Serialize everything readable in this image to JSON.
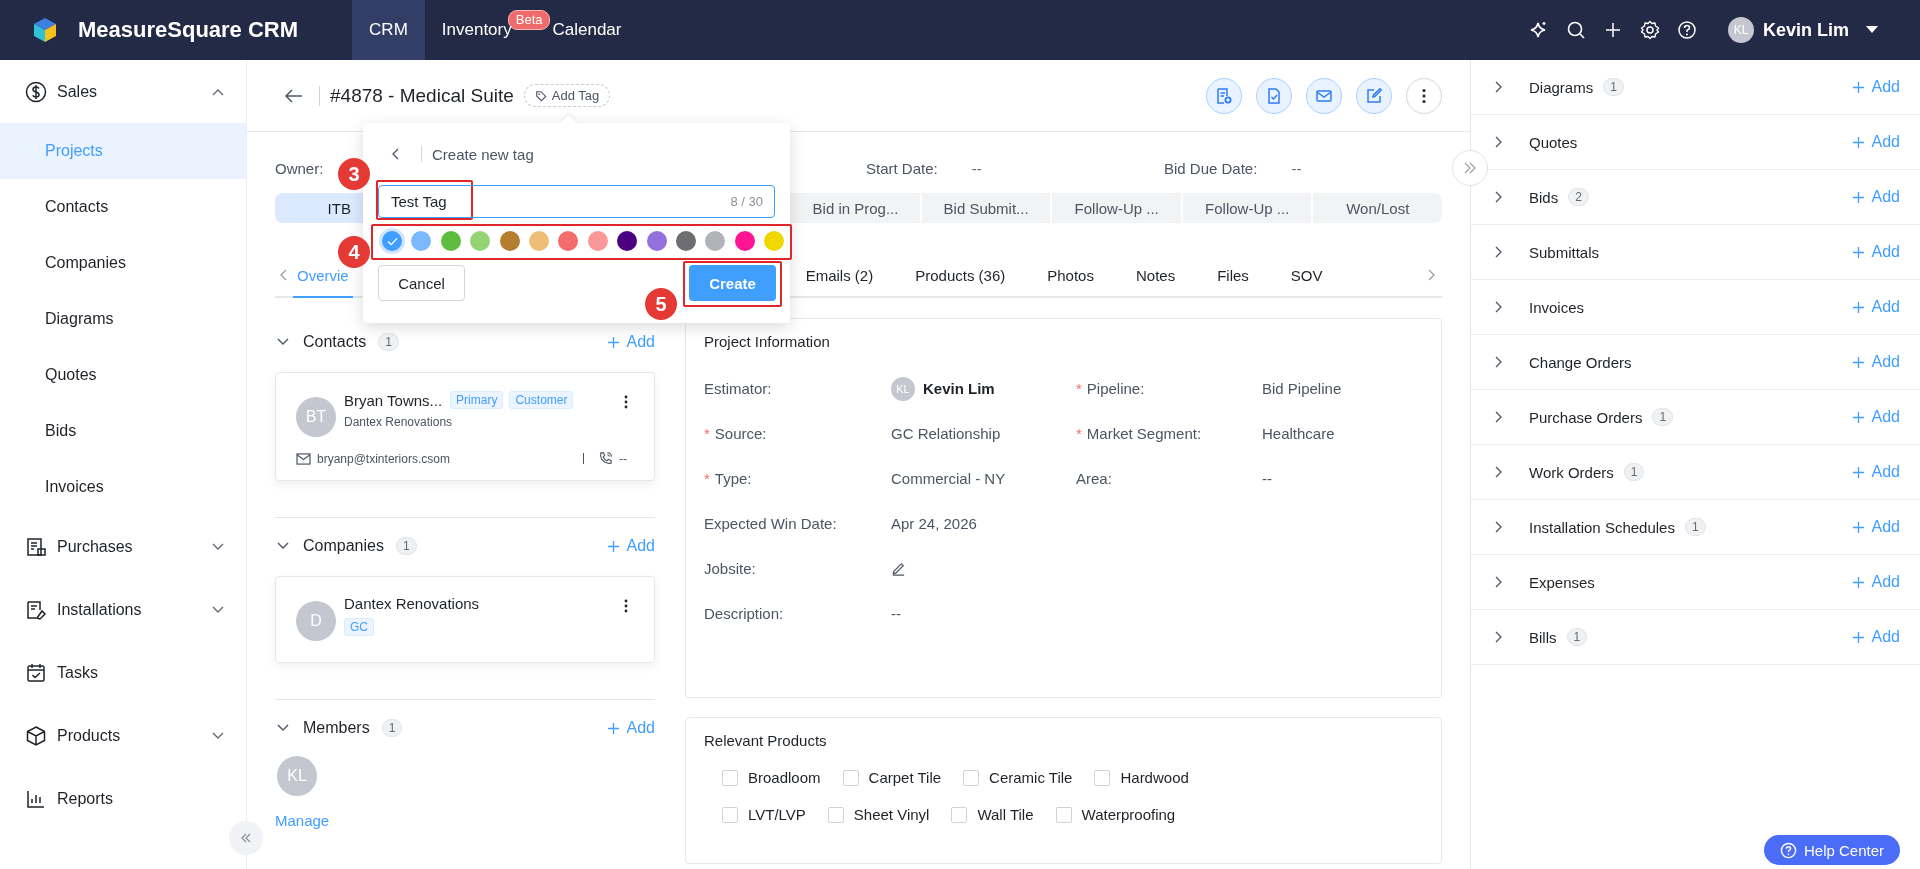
{
  "header": {
    "brand": "MeasureSquare CRM",
    "nav": [
      {
        "label": "CRM",
        "selected": true
      },
      {
        "label": "Inventory",
        "selected": false,
        "badge": "Beta"
      },
      {
        "label": "Calendar",
        "selected": false
      }
    ],
    "user": {
      "initials": "KL",
      "name": "Kevin Lim"
    }
  },
  "sidebar": {
    "groups": [
      {
        "label": "Sales",
        "expanded": true,
        "children": [
          {
            "label": "Projects",
            "selected": true
          },
          {
            "label": "Contacts",
            "selected": false
          },
          {
            "label": "Companies",
            "selected": false
          },
          {
            "label": "Diagrams",
            "selected": false
          },
          {
            "label": "Quotes",
            "selected": false
          },
          {
            "label": "Bids",
            "selected": false
          },
          {
            "label": "Invoices",
            "selected": false
          }
        ]
      },
      {
        "label": "Purchases",
        "expanded": false
      },
      {
        "label": "Installations",
        "expanded": false
      },
      {
        "label": "Tasks"
      },
      {
        "label": "Products",
        "expanded": false
      },
      {
        "label": "Reports"
      }
    ]
  },
  "project": {
    "title": "#4878 - Medical Suite",
    "add_tag": "Add Tag"
  },
  "summary": [
    {
      "label": "Owner:"
    },
    {
      "label": "Start Date:",
      "value": "--"
    },
    {
      "label": "Bid Due Date:",
      "value": "--"
    }
  ],
  "stages": [
    {
      "label": "ITB",
      "selected": true
    },
    {
      "label": "Bid in Prog...",
      "selected": false
    },
    {
      "label": "Bid Submit...",
      "selected": false
    },
    {
      "label": "Follow-Up ...",
      "selected": false
    },
    {
      "label": "Follow-Up ...",
      "selected": false
    },
    {
      "label": "Won/Lost",
      "selected": false
    }
  ],
  "tabs": [
    {
      "label": "Overvie",
      "selected": true
    },
    {
      "label": "Emails (2)",
      "selected": false
    },
    {
      "label": "Products (36)",
      "selected": false
    },
    {
      "label": "Photos",
      "selected": false
    },
    {
      "label": "Notes",
      "selected": false
    },
    {
      "label": "Files",
      "selected": false
    },
    {
      "label": "SOV",
      "selected": false
    }
  ],
  "sections": [
    {
      "kind": "contacts",
      "title": "Contacts",
      "count": "1",
      "add": "Add",
      "cards": [
        {
          "initials": "BT",
          "name": "Bryan Towns...",
          "tags": [
            "Primary",
            "Customer"
          ],
          "company": "Dantex Renovations",
          "email": "bryanp@txinteriors.csom",
          "phone": "--"
        }
      ]
    },
    {
      "kind": "companies",
      "title": "Companies",
      "count": "1",
      "add": "Add",
      "cards": [
        {
          "initials": "D",
          "name": "Dantex Renovations",
          "tags": [
            "GC"
          ]
        }
      ]
    },
    {
      "kind": "members",
      "title": "Members",
      "count": "1",
      "add": "Add",
      "avatars": [
        "KL"
      ],
      "manage": "Manage"
    }
  ],
  "project_info": {
    "title": "Project Information",
    "rows": [
      {
        "fields": [
          {
            "label": "Estimator:",
            "kind": "person",
            "initials": "KL",
            "value": "Kevin Lim"
          },
          {
            "label": "Pipeline:",
            "required_mark": "*",
            "kind": "text",
            "value": "Bid Pipeline"
          }
        ]
      },
      {
        "fields": [
          {
            "label": "Source:",
            "required_mark": "*",
            "kind": "text",
            "value": "GC Relationship"
          },
          {
            "label": "Market Segment:",
            "required_mark": "*",
            "kind": "text",
            "value": "Healthcare"
          }
        ]
      },
      {
        "fields": [
          {
            "label": "Type:",
            "required_mark": "*",
            "kind": "text",
            "value": "Commercial - NY"
          },
          {
            "label": "Area:",
            "kind": "text",
            "value": "--"
          }
        ]
      },
      {
        "fields": [
          {
            "label": "Expected Win Date:",
            "kind": "text",
            "value": "Apr 24, 2026"
          }
        ]
      },
      {
        "fields": [
          {
            "label": "Jobsite:",
            "kind": "edit"
          }
        ]
      },
      {
        "fields": [
          {
            "label": "Description:",
            "kind": "text",
            "value": "--"
          }
        ]
      }
    ]
  },
  "relevant_products": {
    "title": "Relevant Products",
    "options": [
      {
        "label": "Broadloom",
        "checked": false
      },
      {
        "label": "Carpet Tile",
        "checked": false
      },
      {
        "label": "Ceramic Tile",
        "checked": false
      },
      {
        "label": "Hardwood",
        "checked": false
      },
      {
        "label": "LVT/LVP",
        "checked": false
      },
      {
        "label": "Sheet Vinyl",
        "checked": false
      },
      {
        "label": "Wall Tile",
        "checked": false
      },
      {
        "label": "Waterproofing",
        "checked": false
      }
    ]
  },
  "right_panel": {
    "sections": [
      {
        "label": "Diagrams",
        "count": "1",
        "add": "Add"
      },
      {
        "label": "Quotes",
        "add": "Add"
      },
      {
        "label": "Bids",
        "count": "2",
        "add": "Add"
      },
      {
        "label": "Submittals",
        "add": "Add"
      },
      {
        "label": "Invoices",
        "add": "Add"
      },
      {
        "label": "Change Orders",
        "add": "Add"
      },
      {
        "label": "Purchase Orders",
        "count": "1",
        "add": "Add"
      },
      {
        "label": "Work Orders",
        "count": "1",
        "add": "Add"
      },
      {
        "label": "Installation Schedules",
        "count": "1",
        "add": "Add"
      },
      {
        "label": "Expenses",
        "add": "Add"
      },
      {
        "label": "Bills",
        "count": "1",
        "add": "Add"
      }
    ],
    "help": "Help Center"
  },
  "tag_popup": {
    "title": "Create new tag",
    "value": "Test Tag",
    "counter": "8 / 30",
    "colors": [
      {
        "color": "#409eff",
        "selected": true
      },
      {
        "color": "#7ab8ff",
        "selected": false
      },
      {
        "color": "#5ebd3e",
        "selected": false
      },
      {
        "color": "#95d475",
        "selected": false
      },
      {
        "color": "#b57e2e",
        "selected": false
      },
      {
        "color": "#eebe77",
        "selected": false
      },
      {
        "color": "#f56c6c",
        "selected": false
      },
      {
        "color": "#f89898",
        "selected": false
      },
      {
        "color": "#4b0082",
        "selected": false
      },
      {
        "color": "#9370db",
        "selected": false
      },
      {
        "color": "#6c6e72",
        "selected": false
      },
      {
        "color": "#b1b3b8",
        "selected": false
      },
      {
        "color": "#ff1493",
        "selected": false
      },
      {
        "color": "#f0d700",
        "selected": false
      }
    ],
    "cancel": "Cancel",
    "create": "Create",
    "annotations": [
      {
        "number": "3"
      },
      {
        "number": "4"
      },
      {
        "number": "5"
      }
    ]
  }
}
